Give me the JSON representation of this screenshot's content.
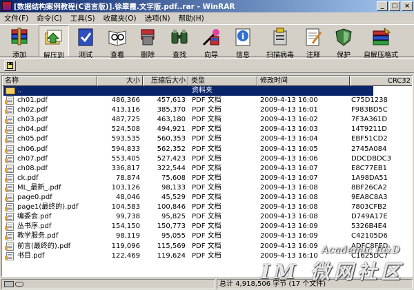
{
  "window": {
    "title": "[数据结构案例教程(C语言版)].徐翠霞.文字版.pdf..rar - WinRAR",
    "controls": [
      "_",
      "□",
      "×"
    ]
  },
  "menu": [
    "文件(F)",
    "命令(C)",
    "工具(S)",
    "收藏夹(O)",
    "选项(N)",
    "帮助(H)"
  ],
  "toolbar": [
    {
      "label": "添加",
      "icon": "add-icon"
    },
    {
      "label": "解压到",
      "icon": "extract-to-icon"
    },
    {
      "label": "测试",
      "icon": "test-icon"
    },
    {
      "label": "查看",
      "icon": "view-icon"
    },
    {
      "label": "删除",
      "icon": "delete-icon"
    },
    {
      "label": "查找",
      "icon": "find-icon"
    },
    {
      "label": "向导",
      "icon": "wizard-icon"
    },
    {
      "label": "信息",
      "icon": "info-icon"
    },
    {
      "label": "扫描病毒",
      "icon": "virus-scan-icon"
    },
    {
      "label": "注释",
      "icon": "comment-icon"
    },
    {
      "label": "保护",
      "icon": "protect-icon"
    },
    {
      "label": "自解压格式",
      "icon": "sfx-icon"
    }
  ],
  "columns": [
    "名称",
    "大小",
    "压缩后大小",
    "类型",
    "修改时间",
    "CRC32"
  ],
  "parent_row": {
    "name": "..",
    "type": "资料夹"
  },
  "files": [
    {
      "name": "ch01.pdf",
      "size": "486,366",
      "packed": "457,613",
      "type": "PDF 文档",
      "modified": "2009-4-13 16:00",
      "crc": "C75D1238"
    },
    {
      "name": "ch02.pdf",
      "size": "413,116",
      "packed": "385,370",
      "type": "PDF 文档",
      "modified": "2009-4-13 16:01",
      "crc": "F983BD5C"
    },
    {
      "name": "ch03.pdf",
      "size": "487,725",
      "packed": "463,180",
      "type": "PDF 文档",
      "modified": "2009-4-13 16:02",
      "crc": "7F3A361D"
    },
    {
      "name": "ch04.pdf",
      "size": "524,508",
      "packed": "494,921",
      "type": "PDF 文档",
      "modified": "2009-4-13 16:03",
      "crc": "14T9211D"
    },
    {
      "name": "ch05.pdf",
      "size": "593,535",
      "packed": "560,353",
      "type": "PDF 文档",
      "modified": "2009-4-13 16:04",
      "crc": "EBF51CD2"
    },
    {
      "name": "ch06.pdf",
      "size": "594,833",
      "packed": "562,352",
      "type": "PDF 文档",
      "modified": "2009-4-13 16:05",
      "crc": "2745A084"
    },
    {
      "name": "ch07.pdf",
      "size": "553,405",
      "packed": "527,423",
      "type": "PDF 文档",
      "modified": "2009-4-13 16:06",
      "crc": "DDCDBDC3"
    },
    {
      "name": "ch08.pdf",
      "size": "336,817",
      "packed": "322,544",
      "type": "PDF 文档",
      "modified": "2009-4-13 16:07",
      "crc": "E8C77EB1"
    },
    {
      "name": "ck.pdf",
      "size": "78,874",
      "packed": "75,608",
      "type": "PDF 文档",
      "modified": "2009-4-13 16:07",
      "crc": "1A98DA51"
    },
    {
      "name": "ML_最新_.pdf",
      "size": "103,126",
      "packed": "98,133",
      "type": "PDF 文档",
      "modified": "2009-4-13 16:08",
      "crc": "8BF26CA2"
    },
    {
      "name": "page0.pdf",
      "size": "48,046",
      "packed": "45,529",
      "type": "PDF 文档",
      "modified": "2009-4-13 16:08",
      "crc": "9EA8C8A3"
    },
    {
      "name": "page1(最终的).pdf",
      "size": "104,583",
      "packed": "100,846",
      "type": "PDF 文档",
      "modified": "2009-4-13 16:08",
      "crc": "7803CFB2"
    },
    {
      "name": "编委会.pdf",
      "size": "99,738",
      "packed": "95,825",
      "type": "PDF 文档",
      "modified": "2009-4-13 16:08",
      "crc": "D749A17E"
    },
    {
      "name": "丛书序.pdf",
      "size": "154,150",
      "packed": "150,773",
      "type": "PDF 文档",
      "modified": "2009-4-13 16:09",
      "crc": "5326B4E4"
    },
    {
      "name": "教学服务.pdf",
      "size": "98,119",
      "packed": "95,055",
      "type": "PDF 文档",
      "modified": "2009-4-13 16:09",
      "crc": "C42105D6"
    },
    {
      "name": "前言(最终的).pdf",
      "size": "119,096",
      "packed": "115,569",
      "type": "PDF 文档",
      "modified": "2009-4-13 16:09",
      "crc": "ADFC8FED"
    },
    {
      "name": "书目.pdf",
      "size": "122,469",
      "packed": "119,624",
      "type": "PDF 文档",
      "modified": "2009-4-13 16:10",
      "crc": "C1625DC7"
    }
  ],
  "status": {
    "total": "总计 4,918,506 字节 (17 个文件)"
  },
  "watermark": {
    "line1": "Academic R&D",
    "line2": "IM 微网社区"
  }
}
